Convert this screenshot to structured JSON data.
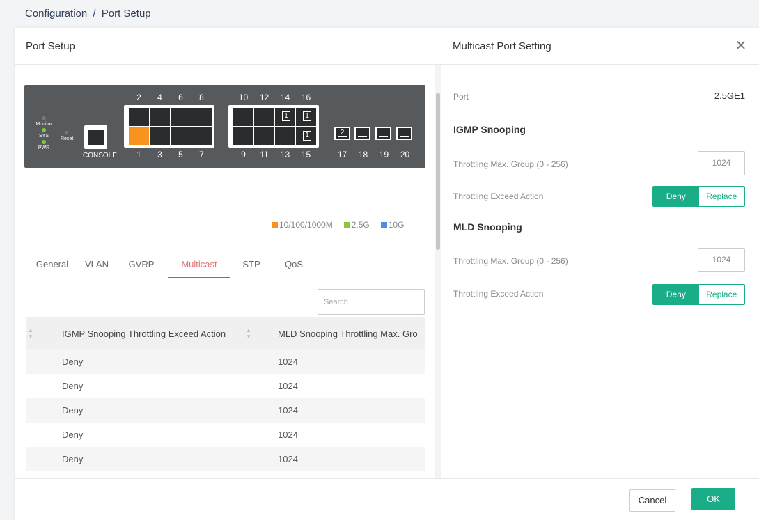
{
  "breadcrumb": {
    "parent": "Configuration",
    "separator": "/",
    "current": "Port Setup"
  },
  "left_panel": {
    "title": "Port Setup"
  },
  "switch": {
    "leds": [
      "Monitor",
      "SYS",
      "PWR"
    ],
    "reset_label": "Reset",
    "console_label": "CONSOLE",
    "top_numbers_a": [
      "2",
      "4",
      "6",
      "8"
    ],
    "bottom_numbers_a": [
      "1",
      "3",
      "5",
      "7"
    ],
    "top_numbers_b": [
      "10",
      "12",
      "14",
      "16"
    ],
    "bottom_numbers_b": [
      "9",
      "11",
      "13",
      "15"
    ],
    "sfp_numbers": [
      "17",
      "18",
      "19",
      "20"
    ],
    "port14_marker": "1",
    "port16_marker": "1",
    "port15_marker": "1",
    "sfp17_marker": "2",
    "port_colors": {
      "active": "#f7941d",
      "idle": "#2b2c2e"
    }
  },
  "legend": [
    {
      "label": "10/100/1000M",
      "color": "#f7941d"
    },
    {
      "label": "2.5G",
      "color": "#8cc63f"
    },
    {
      "label": "10G",
      "color": "#4a90e2"
    }
  ],
  "tabs": [
    "General",
    "VLAN",
    "GVRP",
    "Multicast",
    "STP",
    "QoS"
  ],
  "active_tab": "Multicast",
  "search": {
    "placeholder": "Search"
  },
  "table": {
    "columns": [
      "IGMP Snooping Throttling Exceed Action",
      "MLD Snooping Throttling Max. Gro"
    ],
    "rows": [
      [
        "Deny",
        "1024"
      ],
      [
        "Deny",
        "1024"
      ],
      [
        "Deny",
        "1024"
      ],
      [
        "Deny",
        "1024"
      ],
      [
        "Deny",
        "1024"
      ]
    ]
  },
  "right_panel": {
    "title": "Multicast Port Setting",
    "port_label": "Port",
    "port_value": "2.5GE1",
    "igmp_title": "IGMP Snooping",
    "igmp_max_label": "Throttling Max. Group (0 - 256)",
    "igmp_max_value": "1024",
    "igmp_action_label": "Throttling Exceed Action",
    "mld_title": "MLD Snooping",
    "mld_max_label": "Throttling Max. Group (0 - 256)",
    "mld_max_value": "1024",
    "mld_action_label": "Throttling Exceed Action",
    "deny_label": "Deny",
    "replace_label": "Replace"
  },
  "footer": {
    "cancel_label": "Cancel",
    "ok_label": "OK"
  }
}
